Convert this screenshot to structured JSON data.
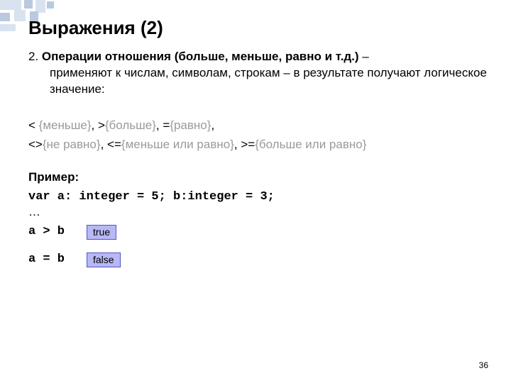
{
  "title": "Выражения (2)",
  "para": {
    "lead_num": "2.",
    "lead_bold": " Операции отношения (больше, меньше, равно и т.д.)",
    "lead_tail": " – применяют к числам, символам, строкам – в результате получают логическое значение:"
  },
  "op1": {
    "a_black": "< ",
    "a_gray": "{меньше}",
    "b_black": ", >",
    "b_gray": "{больше}",
    "c_black": ", =",
    "c_gray": "{равно}",
    "d_black": ","
  },
  "op2": {
    "a_black": "<>",
    "a_gray": "{не равно}",
    "b_black": ", <=",
    "b_gray": "{меньше или равно}",
    "c_black": ", >=",
    "c_gray": "{больше или равно}"
  },
  "example_label": "Пример:",
  "code_decl": "var a: integer = 5;  b:integer = 3;",
  "ellipsis": "…",
  "row1": {
    "expr": "a > b",
    "badge": "true"
  },
  "row2": {
    "expr": "a = b",
    "badge": "false"
  },
  "page_number": "36"
}
